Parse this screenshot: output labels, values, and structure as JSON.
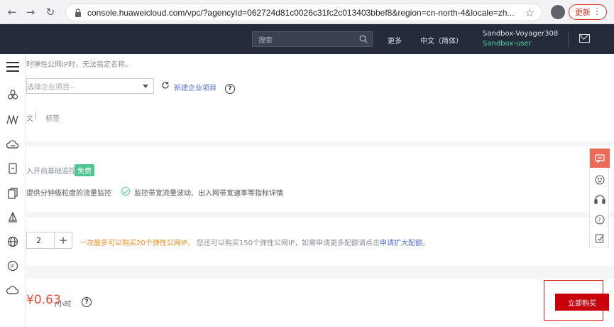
{
  "browser": {
    "url": "console.huaweicloud.com/vpc/?agencyId=062724d81c0026c31fc2c013403bbef8&region=cn-north-4&locale=zh...",
    "update_label": "更新"
  },
  "header": {
    "search_placeholder": "搜索",
    "more": "更多",
    "language": "中文（简体）",
    "user_name": "Sandbox-Voyager308",
    "user_role": "Sandbox-user"
  },
  "form": {
    "name_note": "时弹性公网IP时，无法指定名称。",
    "enterprise_select_placeholder": "选择企业项目--",
    "new_enterprise_project": "新建企业项目",
    "tag_tab_partial": "文",
    "tag_tab_label": "标签",
    "monitor_label": "入开启基础监控",
    "free_badge": "免费",
    "monitor_feature_1": "提供分钟级粒度的流量监控",
    "monitor_feature_2": "监控带宽流量波动、出入网带宽速率等指标详情",
    "quantity_value": "2",
    "quota_orange": "一次最多可以购买20个弹性公网IP。",
    "quota_gray": "您还可以购买150个弹性公网IP，如需申请更多配额请点击",
    "quota_link": "申请扩大配额",
    "quota_end": "。",
    "price": "¥0.63",
    "price_unit": "/小时",
    "buy_button": "立即购买"
  },
  "colors": {
    "accent_red": "#c7000b",
    "price_red": "#e94b3c",
    "free_green": "#4fc591",
    "link_blue": "#526ecc",
    "header_dark": "#252b3a"
  }
}
